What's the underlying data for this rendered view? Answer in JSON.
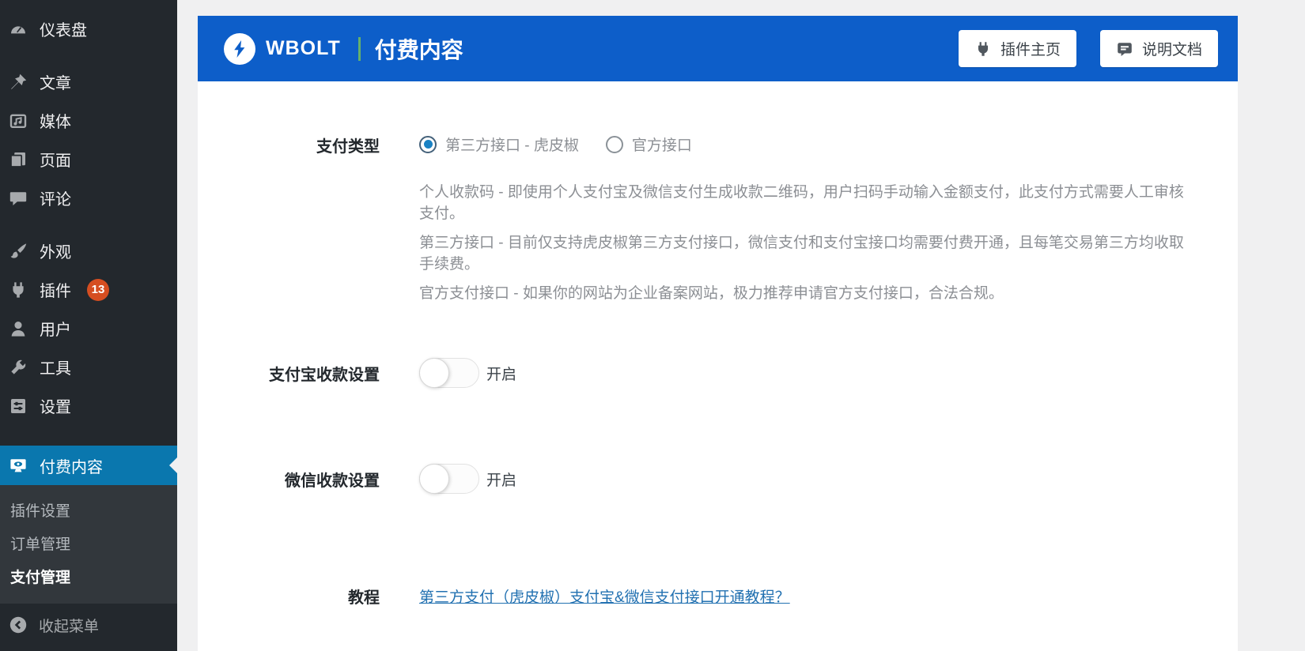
{
  "sidebar": {
    "items": [
      {
        "label": "仪表盘",
        "icon": "dashboard-icon"
      },
      {
        "label": "文章",
        "icon": "pin-icon"
      },
      {
        "label": "媒体",
        "icon": "media-icon"
      },
      {
        "label": "页面",
        "icon": "pages-icon"
      },
      {
        "label": "评论",
        "icon": "comment-icon"
      },
      {
        "label": "外观",
        "icon": "brush-icon"
      },
      {
        "label": "插件",
        "icon": "plug-icon",
        "badge": "13"
      },
      {
        "label": "用户",
        "icon": "user-icon"
      },
      {
        "label": "工具",
        "icon": "wrench-icon"
      },
      {
        "label": "设置",
        "icon": "sliders-icon"
      },
      {
        "label": "付费内容",
        "icon": "paid-content-icon",
        "active": true
      }
    ],
    "submenu": [
      {
        "label": "插件设置"
      },
      {
        "label": "订单管理"
      },
      {
        "label": "支付管理",
        "current": true
      }
    ],
    "collapse_label": "收起菜单"
  },
  "header": {
    "brand": "WBOLT",
    "page_title": "付费内容",
    "buttons": [
      {
        "label": "插件主页",
        "icon": "plug-icon"
      },
      {
        "label": "说明文档",
        "icon": "document-icon"
      }
    ]
  },
  "form": {
    "payment_type": {
      "label": "支付类型",
      "options": [
        {
          "label": "第三方接口 - 虎皮椒",
          "selected": true
        },
        {
          "label": "官方接口",
          "selected": false
        }
      ],
      "descriptions": [
        "个人收款码 - 即使用个人支付宝及微信支付生成收款二维码，用户扫码手动输入金额支付，此支付方式需要人工审核支付。",
        "第三方接口 - 目前仅支持虎皮椒第三方支付接口，微信支付和支付宝接口均需要付费开通，且每笔交易第三方均收取手续费。",
        "官方支付接口 - 如果你的网站为企业备案网站，极力推荐申请官方支付接口，合法合规。"
      ]
    },
    "alipay": {
      "label": "支付宝收款设置",
      "toggle_label": "开启",
      "enabled": false
    },
    "wechat": {
      "label": "微信收款设置",
      "toggle_label": "开启",
      "enabled": false
    },
    "tutorial": {
      "label": "教程",
      "link_text": "第三方支付（虎皮椒）支付宝&微信支付接口开通教程？"
    }
  },
  "colors": {
    "banner_blue": "#0d5ec9",
    "sidebar_bg": "#23282d",
    "active_item_blue": "#0a77ae",
    "badge_orange": "#d54e21",
    "link_blue": "#2271b1"
  }
}
